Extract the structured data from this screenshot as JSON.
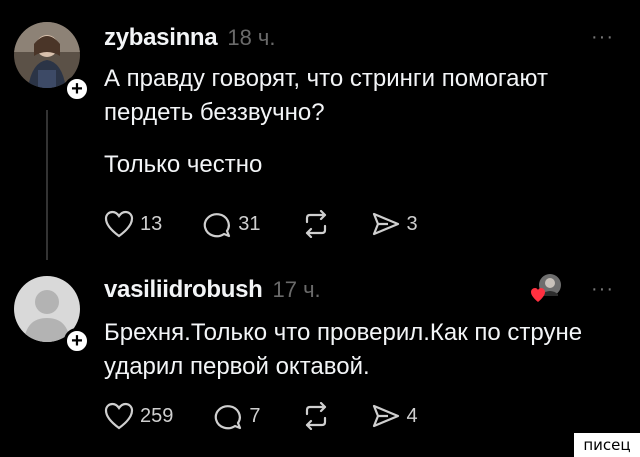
{
  "posts": [
    {
      "username": "zybasinna",
      "time": "18 ч.",
      "text_lines": [
        "А правду говорят, что стринги помогают пердеть беззвучно?",
        "Только честно"
      ],
      "likes": "13",
      "comments": "31",
      "shares": "3",
      "more": "···"
    },
    {
      "username": "vasiliidrobush",
      "time": "17 ч.",
      "text_lines": [
        "Брехня.Только что проверил.Как по струне ударил первой октавой."
      ],
      "likes": "259",
      "comments": "7",
      "shares": "4",
      "more": "···"
    }
  ],
  "follow_symbol": "+",
  "watermark": "писец",
  "icons": {
    "like": "heart-icon",
    "comment": "comment-icon",
    "repost": "repost-icon",
    "share": "share-icon",
    "more": "more-icon"
  },
  "colors": {
    "background": "#000000",
    "text": "#f3f5f7",
    "muted": "#6a6a6a",
    "heart": "#ff3040"
  }
}
